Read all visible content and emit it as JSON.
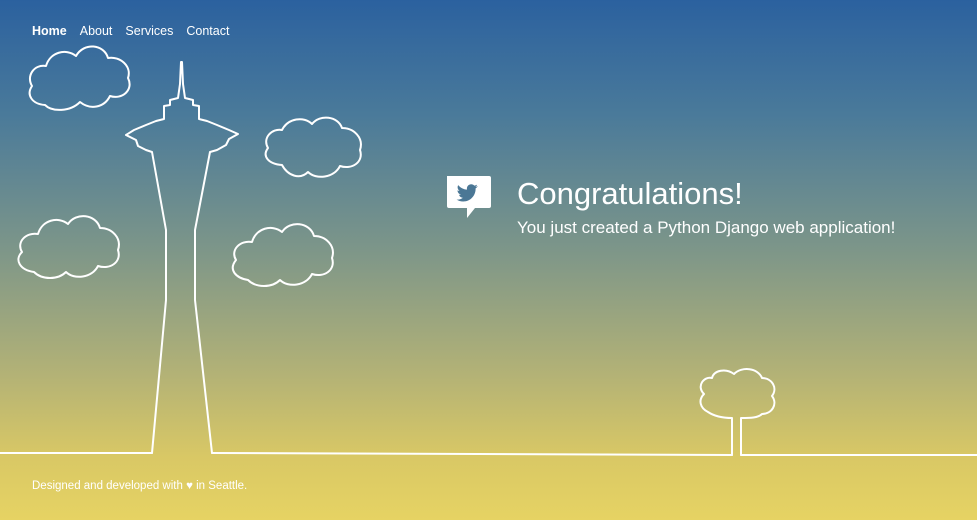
{
  "nav": {
    "items": [
      {
        "label": "Home",
        "active": true
      },
      {
        "label": "About",
        "active": false
      },
      {
        "label": "Services",
        "active": false
      },
      {
        "label": "Contact",
        "active": false
      }
    ]
  },
  "hero": {
    "icon": "twitter-bubble-icon",
    "title": "Congratulations!",
    "subtitle": "You just created a Python Django web application!"
  },
  "footer": {
    "text": "Designed and developed with ♥ in Seattle."
  },
  "colors": {
    "gradient_top": "#2b619f",
    "gradient_bottom": "#e6d363",
    "line": "#ffffff"
  }
}
